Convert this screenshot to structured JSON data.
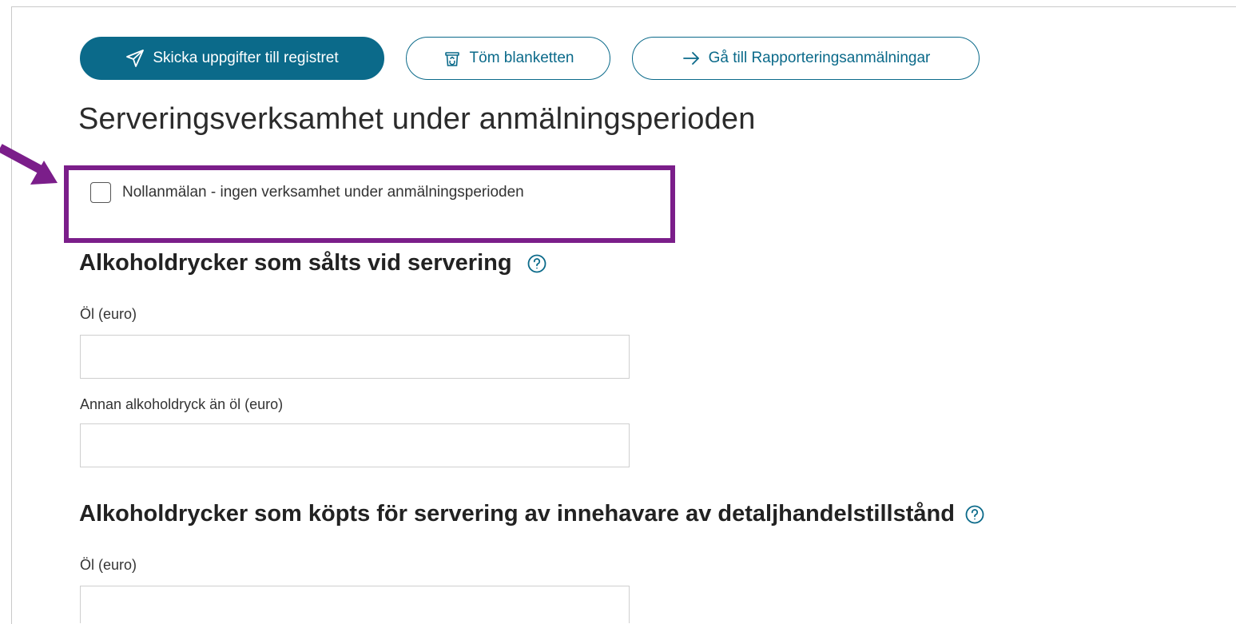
{
  "toolbar": {
    "send_label": "Skicka uppgifter till registret",
    "clear_label": "Töm blanketten",
    "goto_label": "Gå till Rapporteringsanmälningar"
  },
  "page": {
    "title": "Serveringsverksamhet under anmälningsperioden"
  },
  "zero_report": {
    "label": "Nollanmälan - ingen verksamhet under anmälningsperioden",
    "checked": false
  },
  "sections": [
    {
      "heading": "Alkoholdrycker som sålts vid servering",
      "fields": [
        {
          "label": "Öl (euro)",
          "value": ""
        },
        {
          "label": "Annan alkoholdryck än öl (euro)",
          "value": ""
        }
      ]
    },
    {
      "heading": "Alkoholdrycker som köpts för servering av innehavare av detaljhandelstillstånd",
      "fields": [
        {
          "label": "Öl (euro)",
          "value": ""
        }
      ]
    }
  ],
  "colors": {
    "primary": "#0b6a8a",
    "highlight": "#7b1e8a"
  },
  "icons": {
    "send": "paper-plane-icon",
    "clear": "recycle-bin-icon",
    "goto": "arrow-right-icon",
    "help": "question-circle-icon",
    "annotation": "annotation-arrow-icon"
  }
}
